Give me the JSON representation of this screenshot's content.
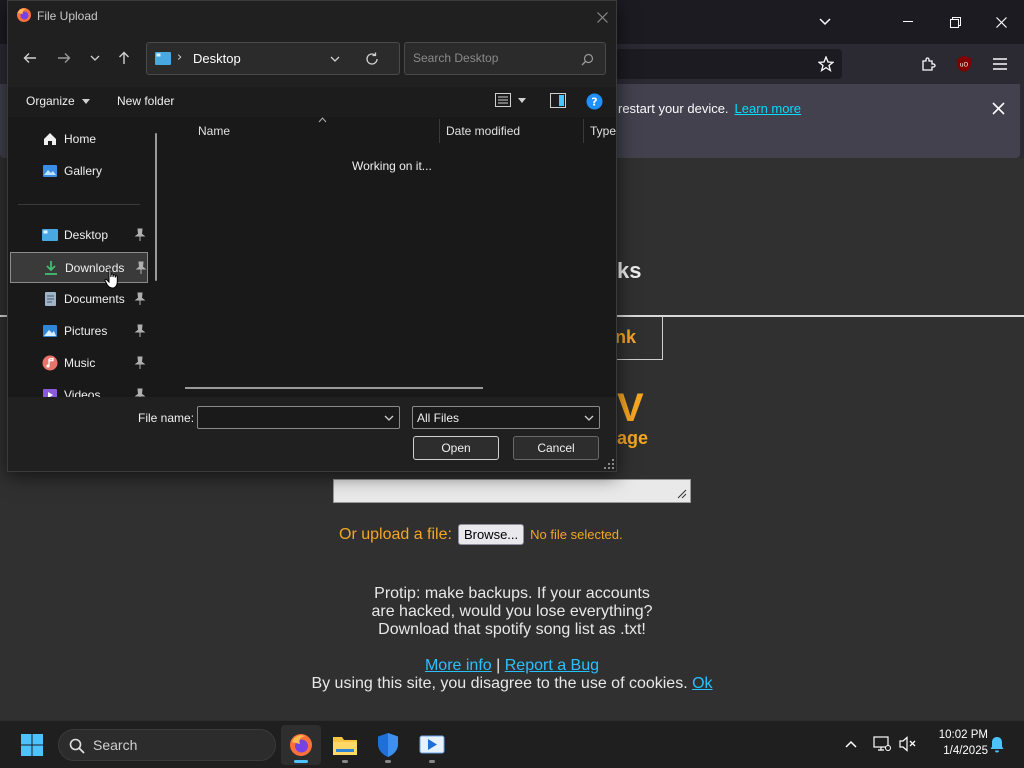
{
  "browser": {
    "notification_text": "restart your device.",
    "notification_link": "Learn more"
  },
  "page": {
    "heading_fragment": "ks",
    "button_fragment": "nk",
    "logo_fragment": "V",
    "subtitle_fragment": "age",
    "upload_label": "Or upload a file:",
    "browse_label": "Browse...",
    "no_file": "No file selected.",
    "protip_lines": [
      "Protip: make backups. If your accounts",
      "are hacked, would you lose everything?",
      "Download that spotify song list as .txt!"
    ],
    "more_info": "More info",
    "separator": "|",
    "report_bug": "Report a Bug",
    "cookie_text": "By using this site, you disagree to the use of cookies.",
    "cookie_ok": "Ok"
  },
  "dialog": {
    "title": "File Upload",
    "address": "Desktop",
    "address_sep": "›",
    "search_placeholder": "Search Desktop",
    "organize": "Organize",
    "new_folder": "New folder",
    "nav_items": [
      {
        "label": "Home",
        "icon": "home-icon"
      },
      {
        "label": "Gallery",
        "icon": "gallery-icon"
      },
      {
        "label": "Desktop",
        "icon": "desktop-icon"
      },
      {
        "label": "Downloads",
        "icon": "downloads-icon"
      },
      {
        "label": "Documents",
        "icon": "documents-icon"
      },
      {
        "label": "Pictures",
        "icon": "pictures-icon"
      },
      {
        "label": "Music",
        "icon": "music-icon"
      },
      {
        "label": "Videos",
        "icon": "videos-icon"
      }
    ],
    "selected_nav": "Downloads",
    "columns": [
      "Name",
      "Date modified",
      "Type"
    ],
    "status": "Working on it...",
    "file_name_label": "File name:",
    "file_name_value": "",
    "file_type": "All Files",
    "open_label": "Open",
    "cancel_label": "Cancel"
  },
  "taskbar": {
    "search_label": "Search",
    "time": "10:02 PM",
    "date": "1/4/2025"
  },
  "colors": {
    "accent": "#4cc2ff",
    "page_orange": "#f5a623",
    "link_blue": "#2bc0ff"
  }
}
